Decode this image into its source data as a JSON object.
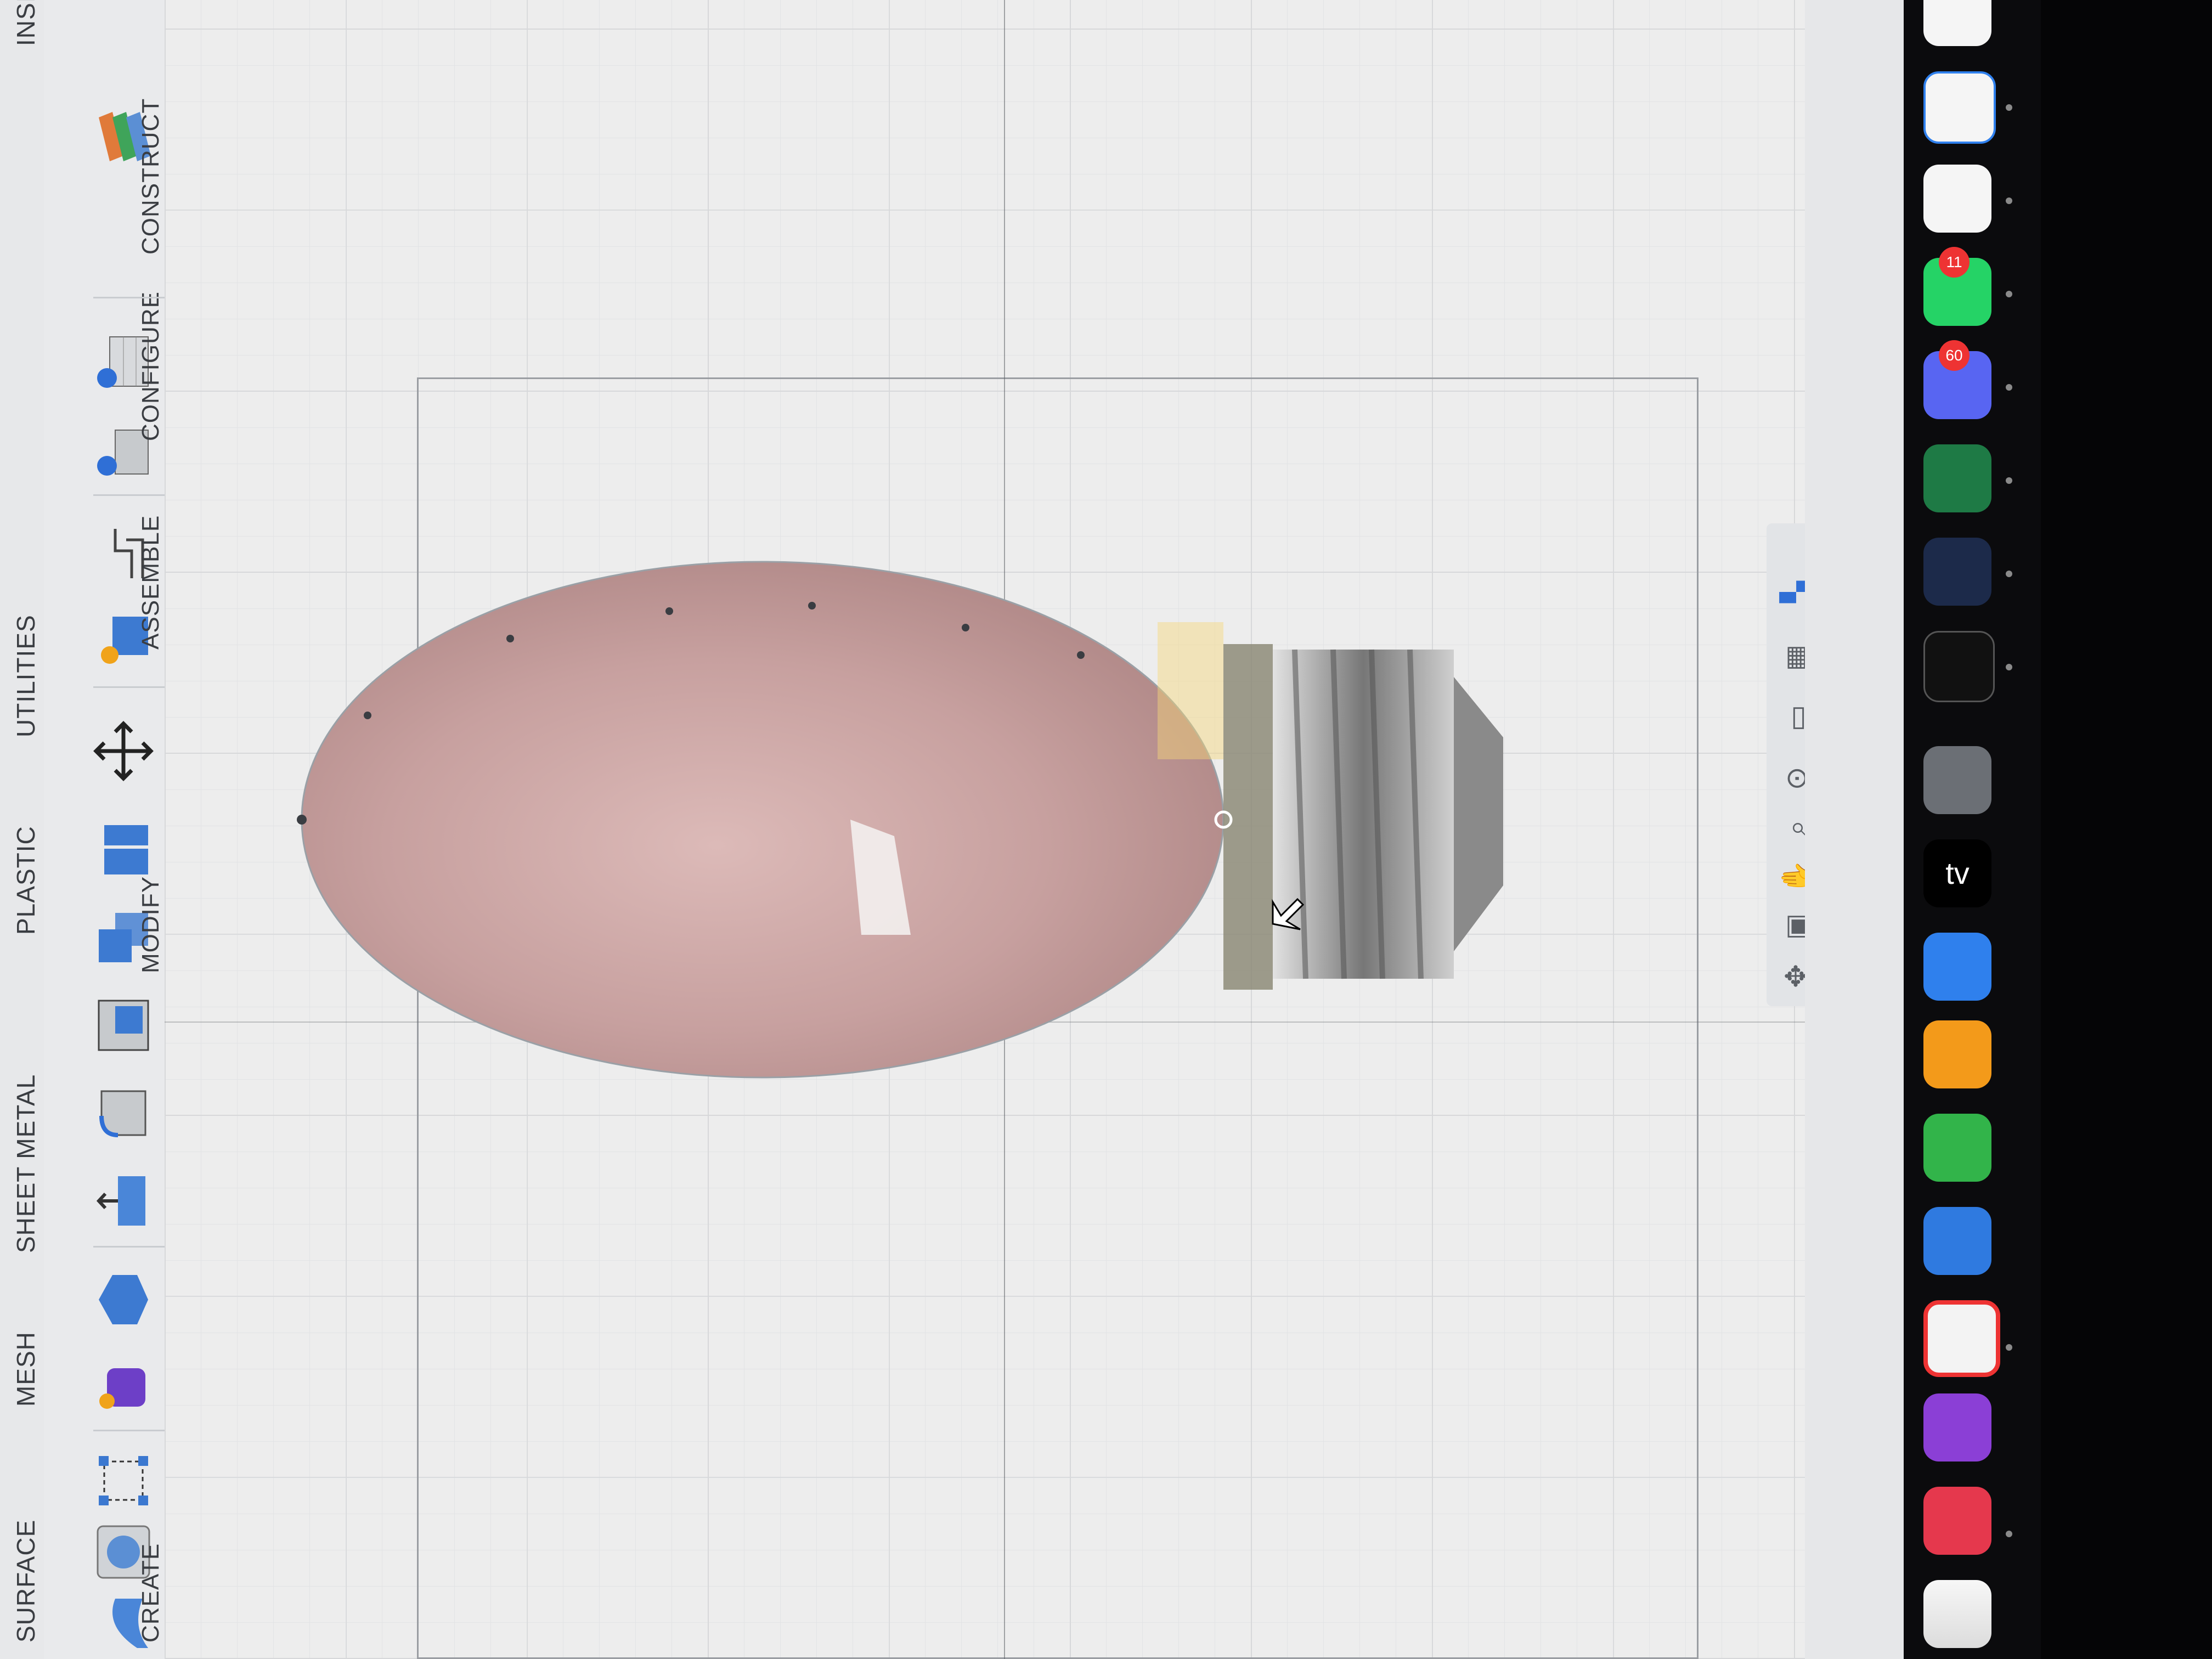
{
  "toolbar": {
    "tabs": [
      "SURFACE",
      "MESH",
      "SHEET METAL",
      "PLASTIC",
      "UTILITIES",
      "INSI"
    ],
    "groups": [
      "CREATE",
      "MODIFY",
      "ASSEMBLE",
      "CONFIGURE",
      "CONSTRUCT"
    ]
  },
  "dock": {
    "apps": [
      {
        "name": "freeform-icon"
      },
      {
        "name": "music-icon"
      },
      {
        "name": "podcasts-icon"
      },
      {
        "name": "news-icon"
      },
      {
        "name": "keynote-icon"
      },
      {
        "name": "numbers-icon"
      },
      {
        "name": "pages-icon"
      },
      {
        "name": "app-store-icon"
      },
      {
        "name": "apple-tv-icon",
        "label": "tv"
      },
      {
        "name": "system-settings-icon"
      },
      {
        "name": "terminal-icon"
      },
      {
        "name": "fusion-icon"
      },
      {
        "name": "excel-icon"
      },
      {
        "name": "discord-icon",
        "badge": "60"
      },
      {
        "name": "whatsapp-icon",
        "badge": "11"
      },
      {
        "name": "chatgpt-icon"
      },
      {
        "name": "vscode-icon"
      },
      {
        "name": "generic-app-icon"
      }
    ]
  },
  "colors": {
    "bulb": "#c9a2a0",
    "base": "#9c9c9c",
    "accent": "#2f6fd6"
  }
}
